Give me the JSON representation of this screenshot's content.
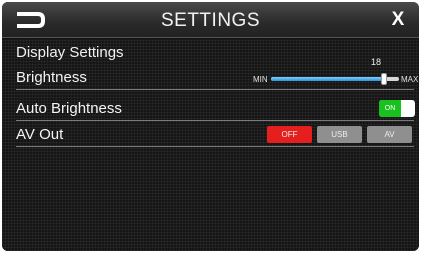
{
  "header": {
    "title": "SETTINGS",
    "close_label": "X"
  },
  "display": {
    "section_title": "Display Settings",
    "brightness": {
      "label": "Brightness",
      "value": 18,
      "min_label": "MIN",
      "max_label": "MAX",
      "level_fraction": 0.88
    },
    "auto_brightness": {
      "label": "Auto Brightness",
      "state": "ON"
    },
    "av_out": {
      "label": "AV Out",
      "options": [
        "OFF",
        "USB",
        "AV"
      ],
      "selected": "OFF"
    }
  },
  "colors": {
    "selected_red": "#e51e1e",
    "toggle_green": "#19c11e",
    "slider_blue": "#2c95dc"
  }
}
